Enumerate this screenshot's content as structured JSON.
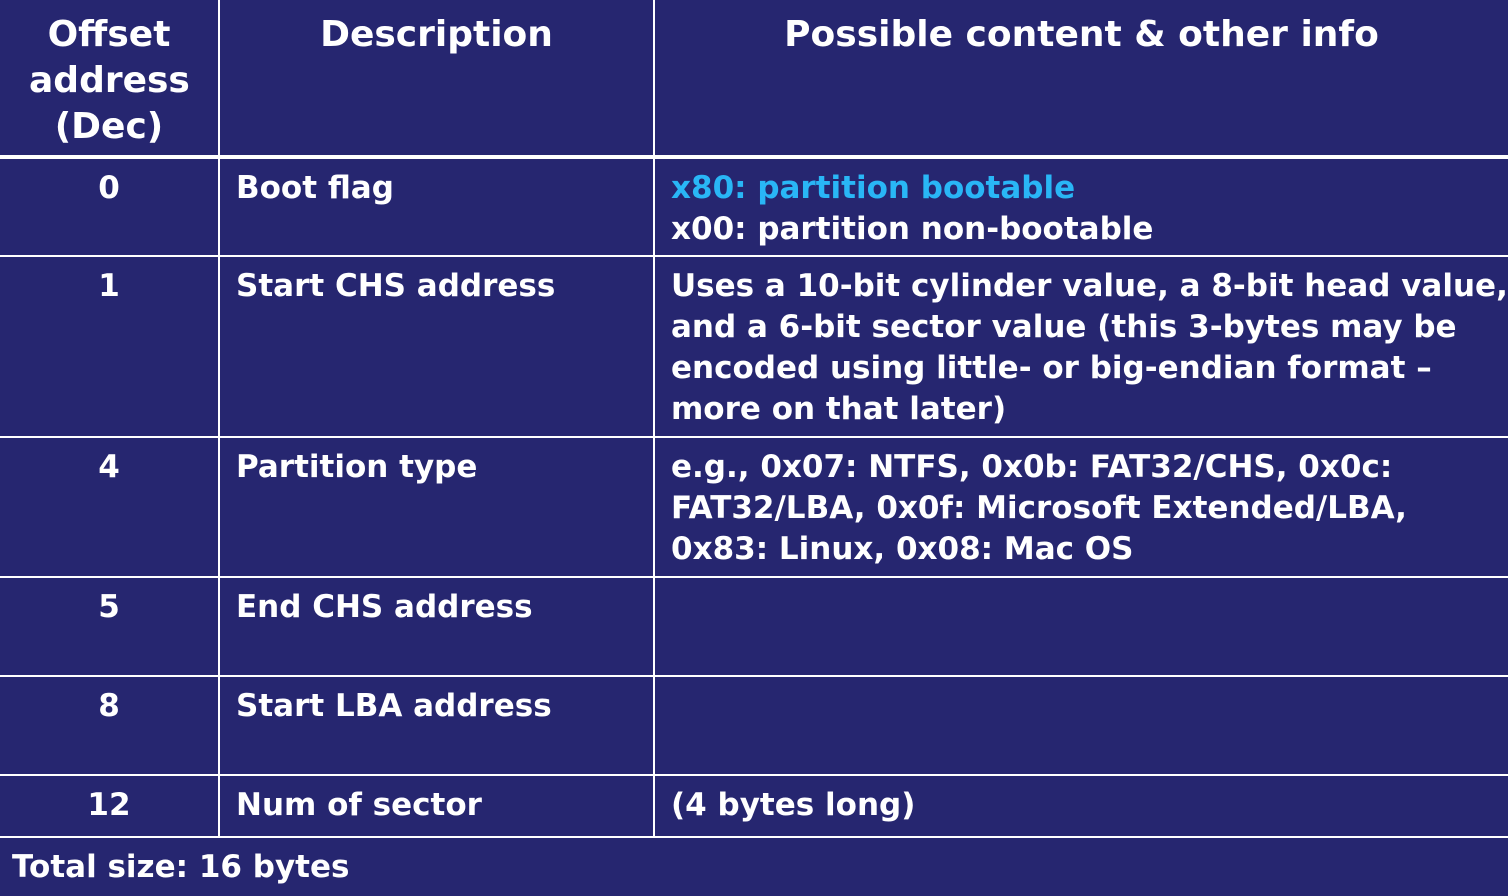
{
  "table": {
    "headers": {
      "offset": "Offset address (Dec)",
      "description": "Description",
      "content": "Possible content & other info"
    },
    "rows": [
      {
        "offset": "0",
        "description": "Boot flag",
        "info_highlight": "x80: partition bootable",
        "info": "x00: partition non-bootable"
      },
      {
        "offset": "1",
        "description": "Start CHS address",
        "info_highlight": "",
        "info": "Uses a 10-bit cylinder value, a 8-bit head value, and a 6-bit sector value (this 3-bytes may be encoded using little- or big-endian format – more on that later)"
      },
      {
        "offset": "4",
        "description": "Partition type",
        "info_highlight": "",
        "info": "e.g., 0x07: NTFS, 0x0b: FAT32/CHS, 0x0c: FAT32/LBA, 0x0f: Microsoft Extended/LBA, 0x83: Linux, 0x08: Mac OS"
      },
      {
        "offset": "5",
        "description": "End CHS address",
        "info_highlight": "",
        "info": ""
      },
      {
        "offset": "8",
        "description": "Start LBA address",
        "info_highlight": "",
        "info": ""
      },
      {
        "offset": "12",
        "description": "Num of sector",
        "info_highlight": "",
        "info": "(4 bytes long)"
      }
    ]
  },
  "footer": {
    "total_size": "Total size: 16 bytes"
  },
  "colors": {
    "background": "#262670",
    "text": "#ffffff",
    "highlight": "#29b6f6",
    "grid": "#ffffff"
  }
}
